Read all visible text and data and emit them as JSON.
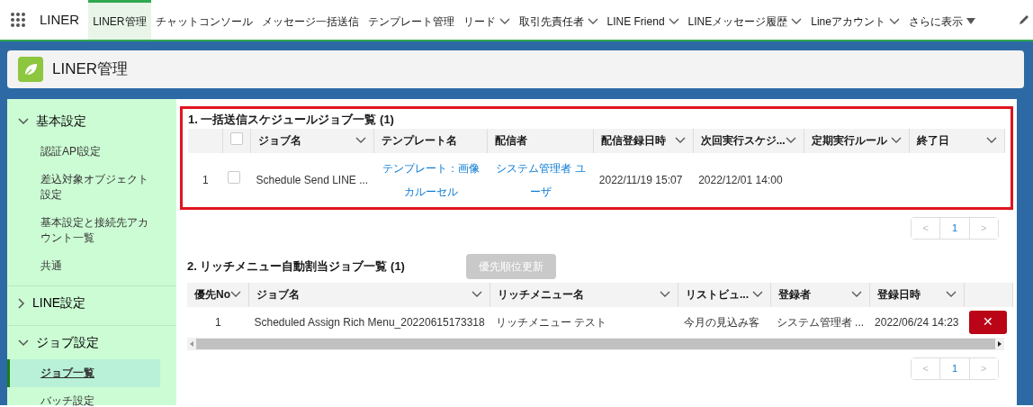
{
  "app": {
    "name": "LINER"
  },
  "nav_tabs": [
    {
      "label": "LINER管理",
      "selected": true,
      "kind": "plain"
    },
    {
      "label": "チャットコンソール",
      "selected": false,
      "kind": "plain"
    },
    {
      "label": "メッセージ一括送信",
      "selected": false,
      "kind": "plain"
    },
    {
      "label": "テンプレート管理",
      "selected": false,
      "kind": "plain"
    },
    {
      "label": "リード",
      "selected": false,
      "kind": "menu"
    },
    {
      "label": "取引先責任者",
      "selected": false,
      "kind": "menu"
    },
    {
      "label": "LINE Friend",
      "selected": false,
      "kind": "menu"
    },
    {
      "label": "LINEメッセージ履歴",
      "selected": false,
      "kind": "menu"
    },
    {
      "label": "Lineアカウント",
      "selected": false,
      "kind": "menu"
    },
    {
      "label": "さらに表示",
      "selected": false,
      "kind": "more"
    }
  ],
  "header": {
    "title": "LINER管理"
  },
  "sidebar": {
    "sections": [
      {
        "label": "基本設定",
        "expanded": true,
        "items": [
          {
            "label": "認証API設定",
            "selected": false
          },
          {
            "label": "差込対象オブジェクト設定",
            "selected": false
          },
          {
            "label": "基本設定と接続先アカウント一覧",
            "selected": false
          },
          {
            "label": "共通",
            "selected": false
          }
        ]
      },
      {
        "label": "LINE設定",
        "expanded": false
      },
      {
        "label": "ジョブ設定",
        "expanded": true,
        "items": [
          {
            "label": "ジョブ一覧",
            "selected": true
          },
          {
            "label": "バッチ設定",
            "selected": false
          }
        ]
      }
    ]
  },
  "schedule_jobs": {
    "title": "1. 一括送信スケジュールジョブ一覧 (1)",
    "highlighted": true,
    "columns": [
      {
        "kind": "number"
      },
      {
        "kind": "checkbox",
        "checked": false
      },
      {
        "kind": "text",
        "label": "ジョブ名",
        "sortable": true
      },
      {
        "kind": "text",
        "label": "テンプレート名",
        "sortable": false
      },
      {
        "kind": "text",
        "label": "配信者",
        "sortable": false
      },
      {
        "kind": "text",
        "label": "配信登録日時",
        "sortable": true
      },
      {
        "kind": "text",
        "label": "次回実行スケジ...",
        "sortable": true
      },
      {
        "kind": "text",
        "label": "定期実行ルール",
        "sortable": true
      },
      {
        "kind": "text",
        "label": "終了日",
        "sortable": true
      }
    ],
    "rows": [
      {
        "cells": [
          {
            "kind": "number",
            "text": "1"
          },
          {
            "kind": "checkbox",
            "checked": false
          },
          {
            "kind": "text",
            "text": "Schedule Send LINE ..."
          },
          {
            "kind": "link",
            "text": "テンプレート：画像カルーセル"
          },
          {
            "kind": "link",
            "text": "システム管理者 ユーザ"
          },
          {
            "kind": "text",
            "text": "2022/11/19 15:07"
          },
          {
            "kind": "text",
            "text": "2022/12/01 14:00"
          },
          {
            "kind": "empty"
          },
          {
            "kind": "empty"
          }
        ]
      }
    ],
    "pagination": {
      "prev": "<",
      "pages": [
        {
          "label": "1",
          "selected": true
        }
      ],
      "next": ">"
    }
  },
  "rich_menu_jobs": {
    "title": "2. リッチメニュー自動割当ジョブ一覧 (1)",
    "button": {
      "label": "優先順位更新",
      "disabled": true
    },
    "columns": [
      {
        "kind": "text",
        "label": "優先No",
        "sortable": true
      },
      {
        "kind": "text",
        "label": "ジョブ名",
        "sortable": true
      },
      {
        "kind": "text",
        "label": "リッチメニュー名",
        "sortable": true
      },
      {
        "kind": "text",
        "label": "リストビュ...",
        "sortable": true
      },
      {
        "kind": "text",
        "label": "登録者",
        "sortable": true
      },
      {
        "kind": "text",
        "label": "登録日時",
        "sortable": true
      },
      {
        "kind": "blank"
      }
    ],
    "rows": [
      {
        "cells": [
          {
            "kind": "number",
            "text": "1"
          },
          {
            "kind": "text",
            "text": "Scheduled Assign Rich Menu_20220615173318"
          },
          {
            "kind": "text",
            "text": "リッチメニュー テスト"
          },
          {
            "kind": "text",
            "text": "今月の見込み客"
          },
          {
            "kind": "text",
            "text": "システム管理者 ..."
          },
          {
            "kind": "text",
            "text": "2022/06/24 14:23"
          },
          {
            "kind": "delete",
            "text": "✕"
          }
        ]
      }
    ],
    "pagination": {
      "prev": "<",
      "pages": [
        {
          "label": "1",
          "selected": true
        }
      ],
      "next": ">"
    }
  }
}
